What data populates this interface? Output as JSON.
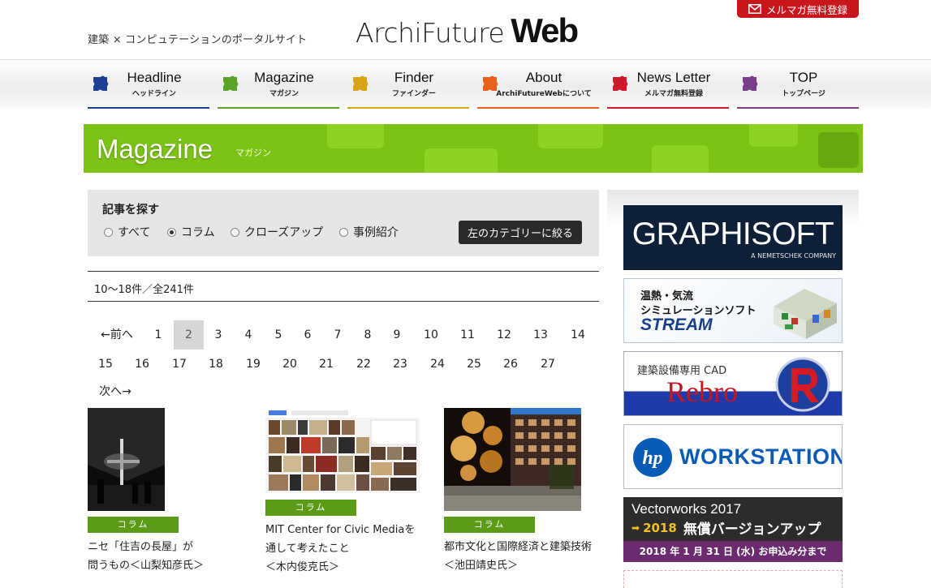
{
  "header": {
    "tagline": "建築 × コンピュテーションのポータルサイト",
    "logo_main": "ArchiFuture",
    "logo_sub": "Web",
    "mail_button": "メルマガ無料登録"
  },
  "nav": {
    "items": [
      {
        "en": "Headline",
        "ja": "ヘッドライン",
        "color": "#1c3f96"
      },
      {
        "en": "Magazine",
        "ja": "マガジン",
        "color": "#5aa428"
      },
      {
        "en": "Finder",
        "ja": "ファインダー",
        "color": "#d9a514"
      },
      {
        "en": "About",
        "ja": "ArchiFutureWebについて",
        "color": "#e8601c"
      },
      {
        "en": "News Letter",
        "ja": "メルマガ無料登録",
        "color": "#d0172c"
      },
      {
        "en": "TOP",
        "ja": "トップページ",
        "color": "#7a3d8a"
      }
    ]
  },
  "banner": {
    "title": "Magazine",
    "subtitle": "マガジン"
  },
  "search": {
    "title": "記事を探す",
    "options": [
      {
        "label": "すべて",
        "selected": false
      },
      {
        "label": "コラム",
        "selected": true
      },
      {
        "label": "クローズアップ",
        "selected": false
      },
      {
        "label": "事例紹介",
        "selected": false
      }
    ],
    "button": "左のカテゴリーに絞る"
  },
  "results": {
    "count": "10～18件／全241件"
  },
  "pagination": {
    "prev": "←前へ",
    "next": "次へ→",
    "current": "2",
    "row1": [
      "1",
      "2",
      "3",
      "4",
      "5",
      "6",
      "7",
      "8",
      "9",
      "10",
      "11",
      "12",
      "13",
      "14"
    ],
    "row2": [
      "15",
      "16",
      "17",
      "18",
      "19",
      "20",
      "21",
      "22",
      "23",
      "24",
      "25",
      "26",
      "27"
    ]
  },
  "articles": [
    {
      "tag": "コラム",
      "title_lines": [
        "ニセ「住吉の長屋」が",
        "問うもの＜山梨知彦氏＞"
      ]
    },
    {
      "tag": "コラム",
      "title_lines": [
        "MIT Center for Civic Mediaを",
        "通して考えたこと",
        "＜木内俊克氏＞"
      ]
    },
    {
      "tag": "コラム",
      "title_lines": [
        "都市文化と国際経済と建築技術",
        "＜池田靖史氏＞"
      ]
    }
  ],
  "ads": {
    "graphisoft": {
      "name": "GRAPHISOFT",
      "sub": "A NEMETSCHEK COMPANY"
    },
    "stream": {
      "line1": "温熱・気流",
      "line2": "シミュレーションソフト",
      "name": "STREAM"
    },
    "rebro": {
      "line1": "建築設備専用 CAD",
      "name": "Rebro"
    },
    "hp": {
      "logo": "hp",
      "name": "WORKSTATIONS"
    },
    "vectorworks": {
      "line1": "Vectorworks 2017",
      "year": "2018",
      "upgrade": "無償バージョンアップ",
      "deadline": "2018 年 1 月 31 日 (水) お申込み分まで"
    }
  }
}
